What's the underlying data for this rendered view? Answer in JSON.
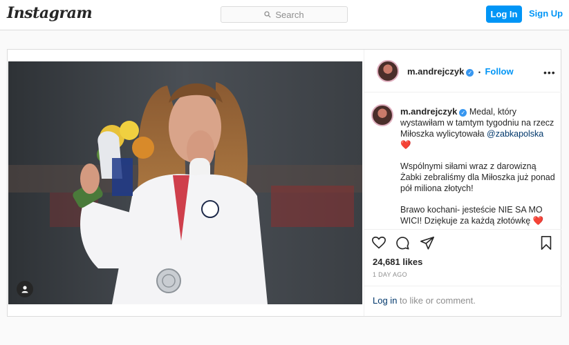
{
  "header": {
    "logo_text": "Instagram",
    "search_placeholder": "Search",
    "login_label": "Log In",
    "signup_label": "Sign Up"
  },
  "post": {
    "username": "m.andrejczyk",
    "follow_label": "Follow",
    "dot_separator": "•",
    "more_label": "•••",
    "caption_p1": "Medal, który wystawiłam w tamtym tygodniu na rzecz Miłoszka wylicytowała",
    "caption_mention": "@zabkapolska",
    "caption_p2": "Wspólnymi siłami wraz z darowizną Żabki zebraliśmy dla Miłoszka już ponad pół miliona złotych!",
    "caption_p3": "Brawo kochani- jesteście NIE SA MO WICI! Dziękuje za każdą złotówkę",
    "heart_emoji": "❤️",
    "likes_count": "24,681",
    "likes_label": "likes",
    "timestamp": "1 DAY AGO",
    "comment_login_link": "Log in",
    "comment_rest": " to like or comment."
  },
  "colors": {
    "accent": "#0095f6",
    "border": "#dbdbdb",
    "background": "#fafafa"
  }
}
